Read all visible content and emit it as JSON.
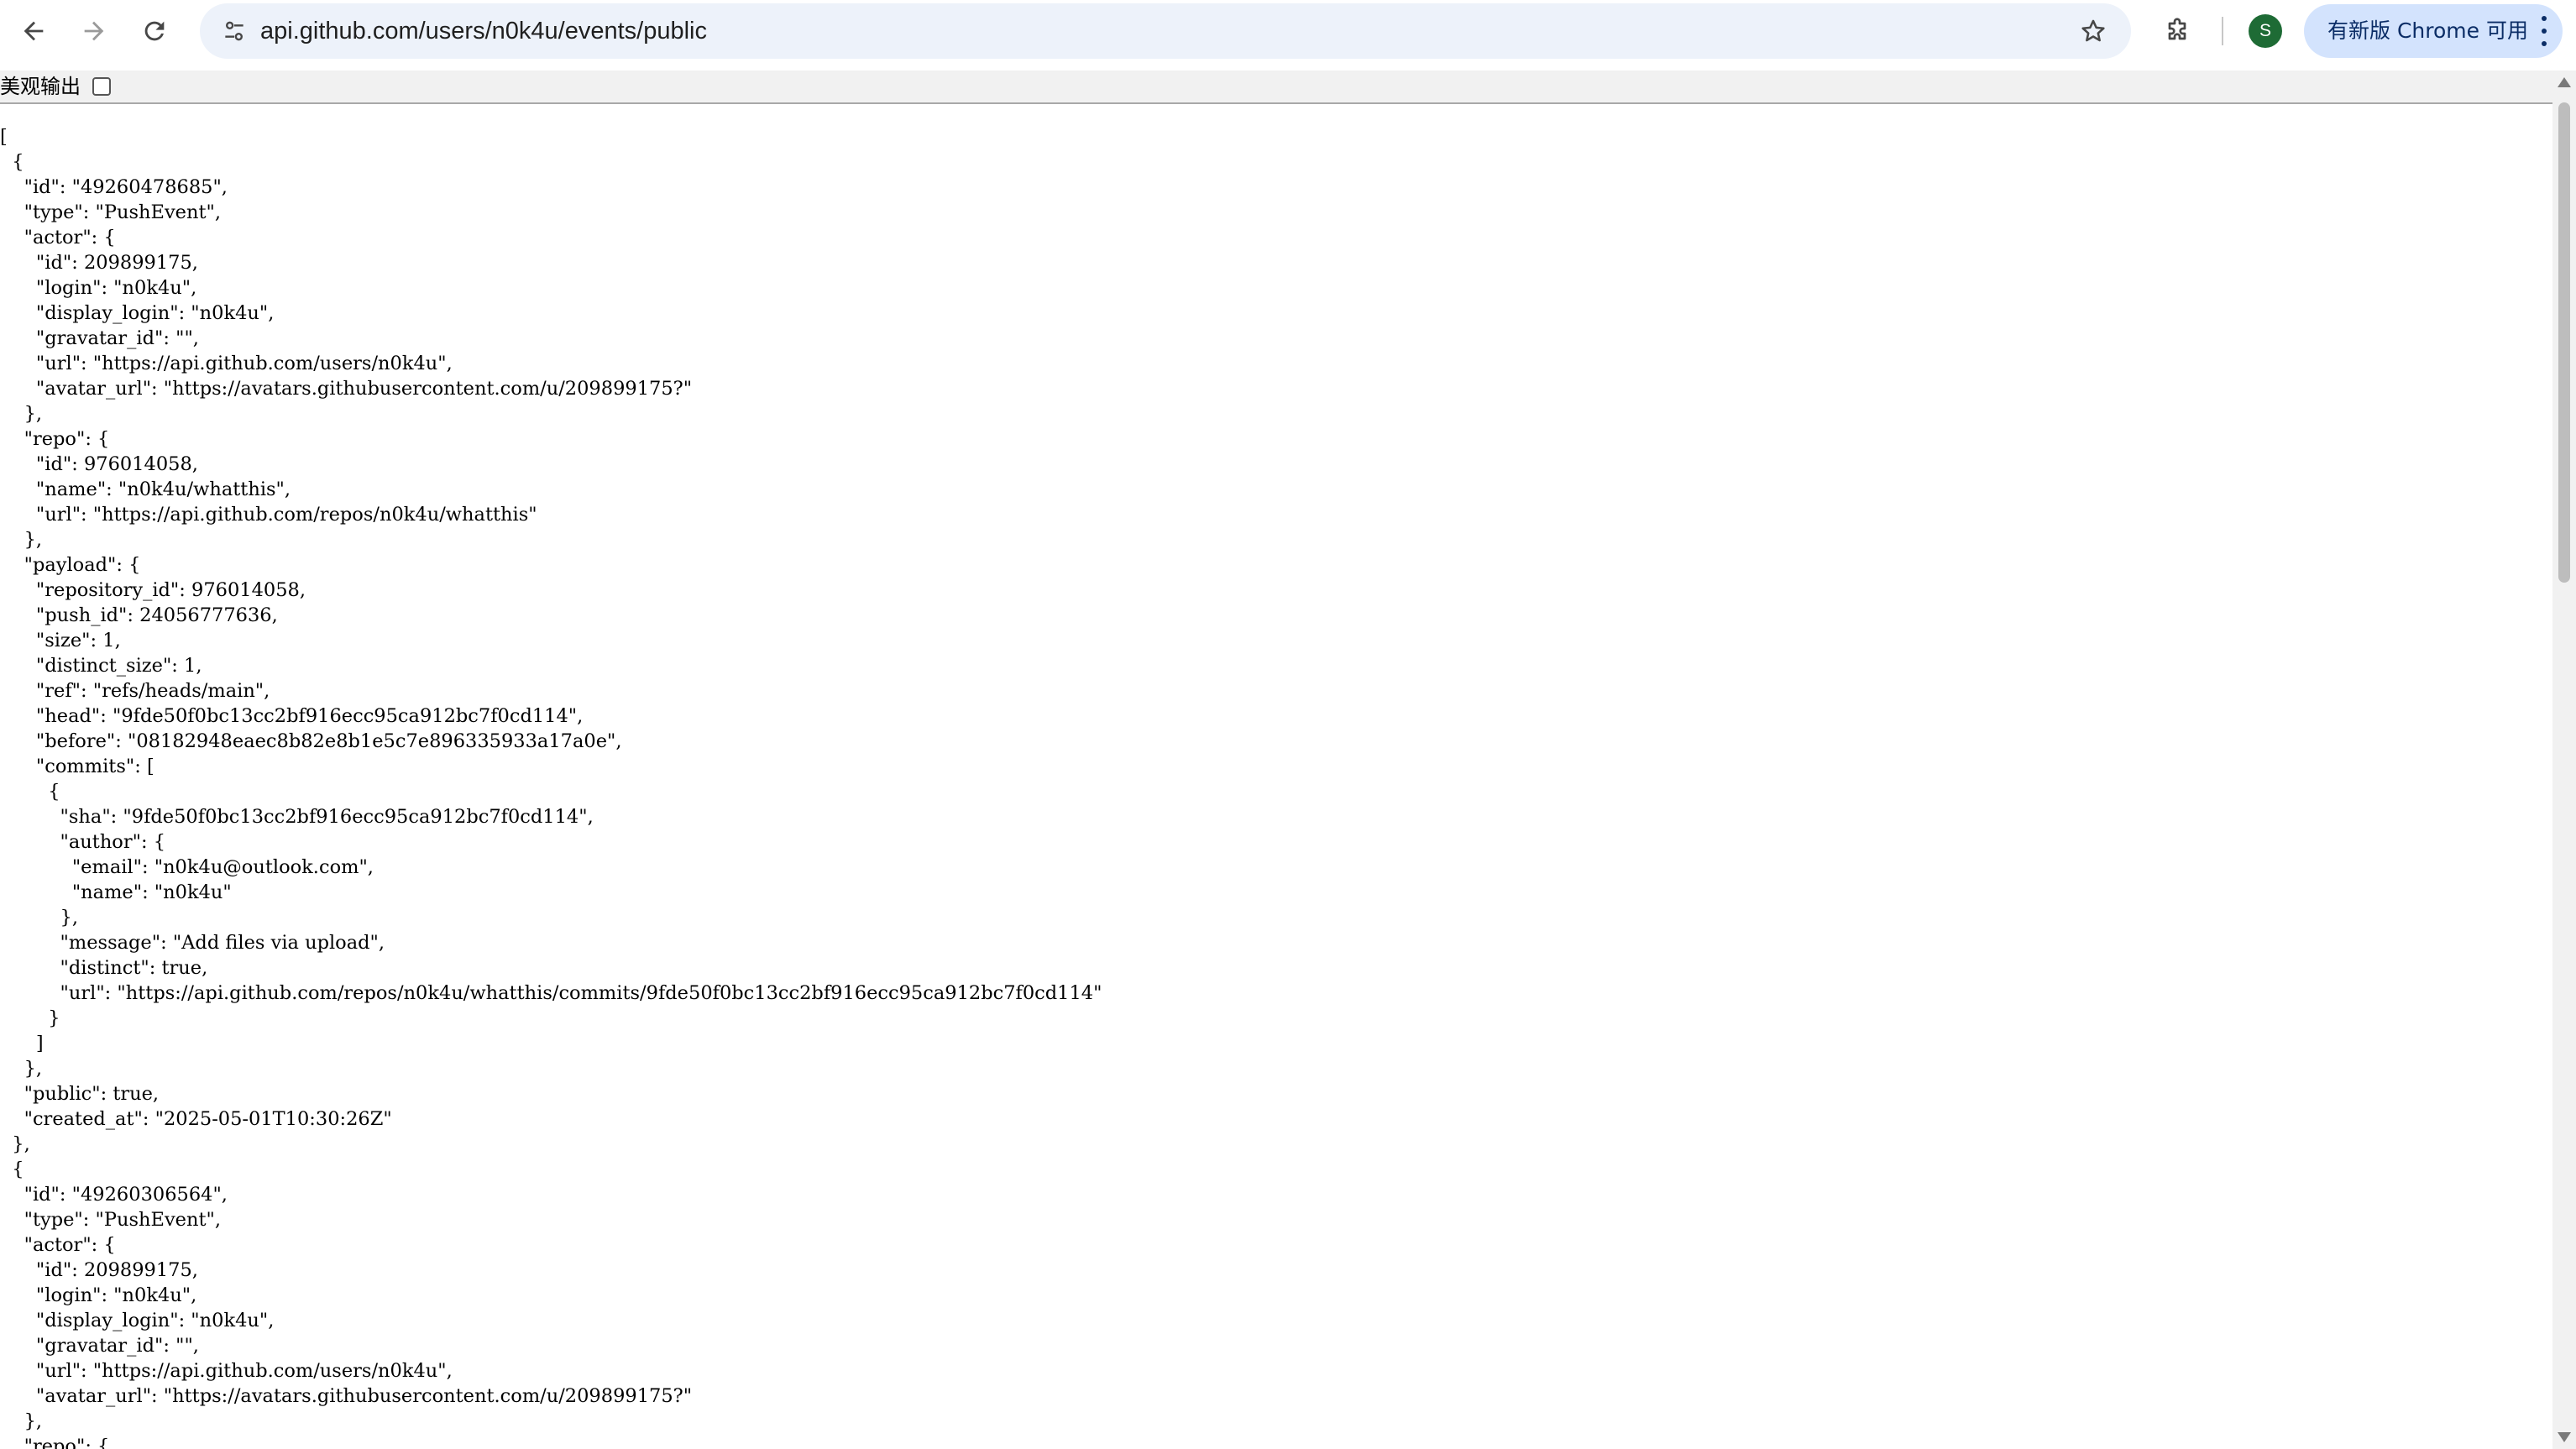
{
  "browser": {
    "address_bar": {
      "url": "api.github.com/users/n0k4u/events/public"
    },
    "profile_initial": "S",
    "update_chip_label": "有新版 Chrome 可用",
    "icons": {
      "back": "arrow-left-icon",
      "forward": "arrow-right-icon",
      "reload": "reload-icon",
      "site_info": "tune-icon",
      "bookmark": "star-icon",
      "extensions": "puzzle-icon",
      "menu": "three-dots-icon"
    },
    "colors": {
      "omnibox_bg": "#edf2fa",
      "avatar_bg": "#1e6b35",
      "update_chip_bg": "#d3e3fd"
    }
  },
  "pretty_print": {
    "label": "美观输出",
    "checked": false
  },
  "json_text": "[\n  {\n    \"id\": \"49260478685\",\n    \"type\": \"PushEvent\",\n    \"actor\": {\n      \"id\": 209899175,\n      \"login\": \"n0k4u\",\n      \"display_login\": \"n0k4u\",\n      \"gravatar_id\": \"\",\n      \"url\": \"https://api.github.com/users/n0k4u\",\n      \"avatar_url\": \"https://avatars.githubusercontent.com/u/209899175?\"\n    },\n    \"repo\": {\n      \"id\": 976014058,\n      \"name\": \"n0k4u/whatthis\",\n      \"url\": \"https://api.github.com/repos/n0k4u/whatthis\"\n    },\n    \"payload\": {\n      \"repository_id\": 976014058,\n      \"push_id\": 24056777636,\n      \"size\": 1,\n      \"distinct_size\": 1,\n      \"ref\": \"refs/heads/main\",\n      \"head\": \"9fde50f0bc13cc2bf916ecc95ca912bc7f0cd114\",\n      \"before\": \"08182948eaec8b82e8b1e5c7e896335933a17a0e\",\n      \"commits\": [\n        {\n          \"sha\": \"9fde50f0bc13cc2bf916ecc95ca912bc7f0cd114\",\n          \"author\": {\n            \"email\": \"n0k4u@outlook.com\",\n            \"name\": \"n0k4u\"\n          },\n          \"message\": \"Add files via upload\",\n          \"distinct\": true,\n          \"url\": \"https://api.github.com/repos/n0k4u/whatthis/commits/9fde50f0bc13cc2bf916ecc95ca912bc7f0cd114\"\n        }\n      ]\n    },\n    \"public\": true,\n    \"created_at\": \"2025-05-01T10:30:26Z\"\n  },\n  {\n    \"id\": \"49260306564\",\n    \"type\": \"PushEvent\",\n    \"actor\": {\n      \"id\": 209899175,\n      \"login\": \"n0k4u\",\n      \"display_login\": \"n0k4u\",\n      \"gravatar_id\": \"\",\n      \"url\": \"https://api.github.com/users/n0k4u\",\n      \"avatar_url\": \"https://avatars.githubusercontent.com/u/209899175?\"\n    },\n    \"repo\": {"
}
